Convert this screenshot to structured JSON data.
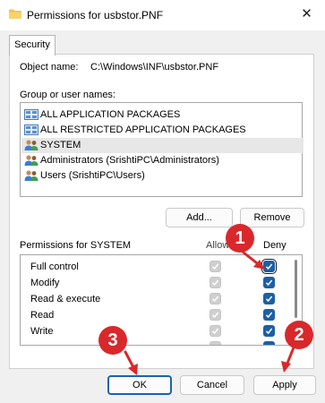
{
  "window": {
    "title": "Permissions for usbstor.PNF",
    "close_glyph": "✕"
  },
  "tabs": [
    {
      "label": "Security"
    }
  ],
  "object": {
    "label": "Object name:",
    "value": "C:\\Windows\\INF\\usbstor.PNF"
  },
  "groups": {
    "label": "Group or user names:",
    "items": [
      {
        "name": "ALL APPLICATION PACKAGES",
        "icon": "package-icon"
      },
      {
        "name": "ALL RESTRICTED APPLICATION PACKAGES",
        "icon": "package-icon"
      },
      {
        "name": "SYSTEM",
        "icon": "users-icon",
        "selected": true
      },
      {
        "name": "Administrators (SrishtiPC\\Administrators)",
        "icon": "users-icon"
      },
      {
        "name": "Users (SrishtiPC\\Users)",
        "icon": "users-icon"
      }
    ]
  },
  "buttons": {
    "add": "Add...",
    "remove": "Remove",
    "ok": "OK",
    "cancel": "Cancel",
    "apply": "Apply"
  },
  "permissions": {
    "header": "Permissions for SYSTEM",
    "allow_label": "Allow",
    "deny_label": "Deny",
    "rows": [
      {
        "name": "Full control",
        "allow": true,
        "deny": true
      },
      {
        "name": "Modify",
        "allow": true,
        "deny": true
      },
      {
        "name": "Read & execute",
        "allow": true,
        "deny": true
      },
      {
        "name": "Read",
        "allow": true,
        "deny": true
      },
      {
        "name": "Write",
        "allow": true,
        "deny": true
      }
    ]
  },
  "markers": {
    "m1": "1",
    "m2": "2",
    "m3": "3"
  },
  "colors": {
    "marker": "#d9282b",
    "accent": "#1c5fa7"
  }
}
